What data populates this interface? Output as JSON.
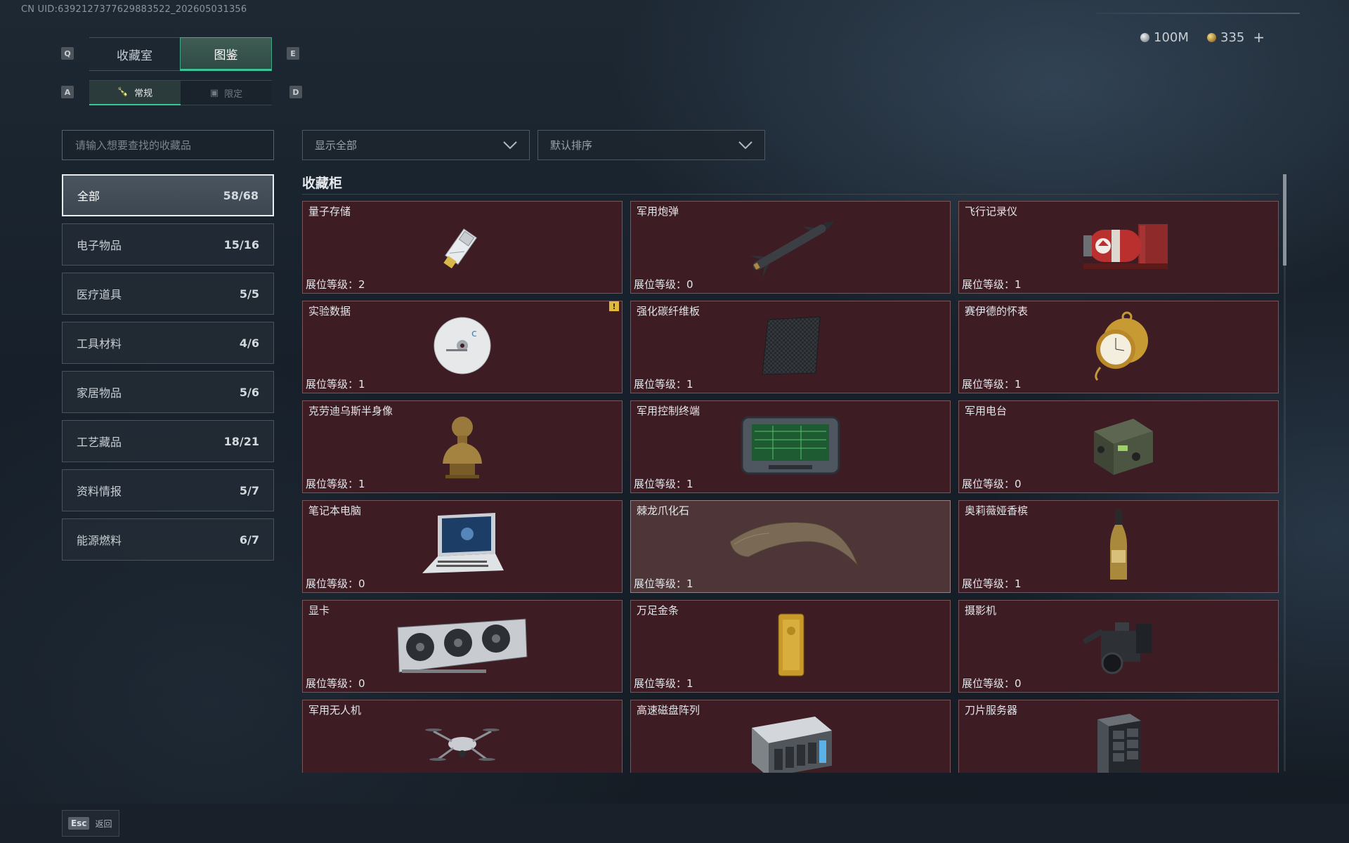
{
  "header": {
    "uid": "CN UID:6392127377629883522_2026050313​56",
    "key_left": "Q",
    "key_right": "E",
    "key_sub_left": "A",
    "key_sub_right": "D",
    "tabs": [
      {
        "label": "收藏室",
        "active": false
      },
      {
        "label": "图鉴",
        "active": true
      }
    ],
    "sub_tabs": [
      {
        "label": "常规",
        "icon": "bottle-icon",
        "active": true
      },
      {
        "label": "限定",
        "icon": "image-icon",
        "active": false
      }
    ],
    "currency_silver": "100M",
    "currency_gold": "335",
    "add_label": "+"
  },
  "search": {
    "placeholder": "请输入想要查找的收藏品"
  },
  "filters": {
    "show": "显示全部",
    "sort": "默认排序"
  },
  "categories": [
    {
      "label": "全部",
      "count": "58/68",
      "active": true
    },
    {
      "label": "电子物品",
      "count": "15/16"
    },
    {
      "label": "医疗道具",
      "count": "5/5"
    },
    {
      "label": "工具材料",
      "count": "4/6"
    },
    {
      "label": "家居物品",
      "count": "5/6"
    },
    {
      "label": "工艺藏品",
      "count": "18/21"
    },
    {
      "label": "资料情报",
      "count": "5/7"
    },
    {
      "label": "能源燃料",
      "count": "6/7"
    }
  ],
  "section_title": "收藏柜",
  "items": [
    {
      "name": "量子存储",
      "level": "展位等级：2",
      "icon": "usb-drive-icon"
    },
    {
      "name": "军用炮弹",
      "level": "展位等级：0",
      "icon": "missile-icon"
    },
    {
      "name": "飞行记录仪",
      "level": "展位等级：1",
      "icon": "flight-recorder-icon"
    },
    {
      "name": "实验数据",
      "level": "展位等级：1",
      "icon": "disc-icon",
      "badge": "!"
    },
    {
      "name": "强化碳纤维板",
      "level": "展位等级：1",
      "icon": "carbon-plate-icon"
    },
    {
      "name": "赛伊德的怀表",
      "level": "展位等级：1",
      "icon": "pocket-watch-icon"
    },
    {
      "name": "克劳迪乌斯半身像",
      "level": "展位等级：1",
      "icon": "bust-icon"
    },
    {
      "name": "军用控制终端",
      "level": "展位等级：1",
      "icon": "terminal-icon"
    },
    {
      "name": "军用电台",
      "level": "展位等级：0",
      "icon": "radio-icon"
    },
    {
      "name": "笔记本电脑",
      "level": "展位等级：0",
      "icon": "laptop-icon"
    },
    {
      "name": "棘龙爪化石",
      "level": "展位等级：1",
      "icon": "claw-fossil-icon",
      "highlight": true
    },
    {
      "name": "奥莉薇娅香槟",
      "level": "展位等级：1",
      "icon": "champagne-icon"
    },
    {
      "name": "显卡",
      "level": "展位等级：0",
      "icon": "graphics-card-icon"
    },
    {
      "name": "万足金条",
      "level": "展位等级：1",
      "icon": "gold-bar-icon"
    },
    {
      "name": "摄影机",
      "level": "展位等级：0",
      "icon": "camera-icon"
    },
    {
      "name": "军用无人机",
      "level": "",
      "icon": "drone-icon"
    },
    {
      "name": "高速磁盘阵列",
      "level": "",
      "icon": "disk-array-icon"
    },
    {
      "name": "刀片服务器",
      "level": "",
      "icon": "blade-server-icon"
    }
  ],
  "footer": {
    "esc_key": "Esc",
    "back_label": "返回"
  }
}
